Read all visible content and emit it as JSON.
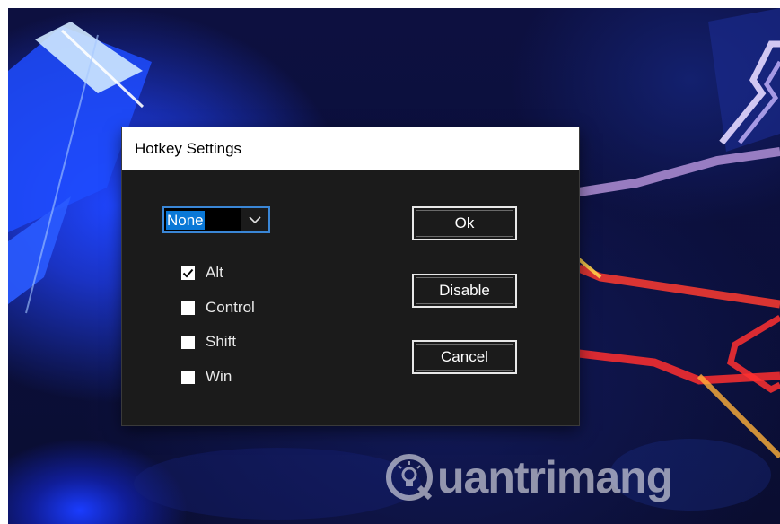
{
  "dialog": {
    "title": "Hotkey Settings",
    "key_select": {
      "value": "None"
    },
    "modifiers": [
      {
        "label": "Alt",
        "checked": true
      },
      {
        "label": "Control",
        "checked": false
      },
      {
        "label": "Shift",
        "checked": false
      },
      {
        "label": "Win",
        "checked": false
      }
    ],
    "buttons": {
      "ok": "Ok",
      "disable": "Disable",
      "cancel": "Cancel"
    }
  },
  "watermark": {
    "text": "uantrimang"
  },
  "colors": {
    "dialog_bg": "#1b1b1b",
    "titlebar_bg": "#ffffff",
    "selection_blue": "#0a78d7",
    "focus_border": "#3a86d6"
  },
  "icons": {
    "dropdown": "chevron-down-icon",
    "checkmark": "checkmark-icon",
    "logo": "lightbulb-logo-icon"
  }
}
